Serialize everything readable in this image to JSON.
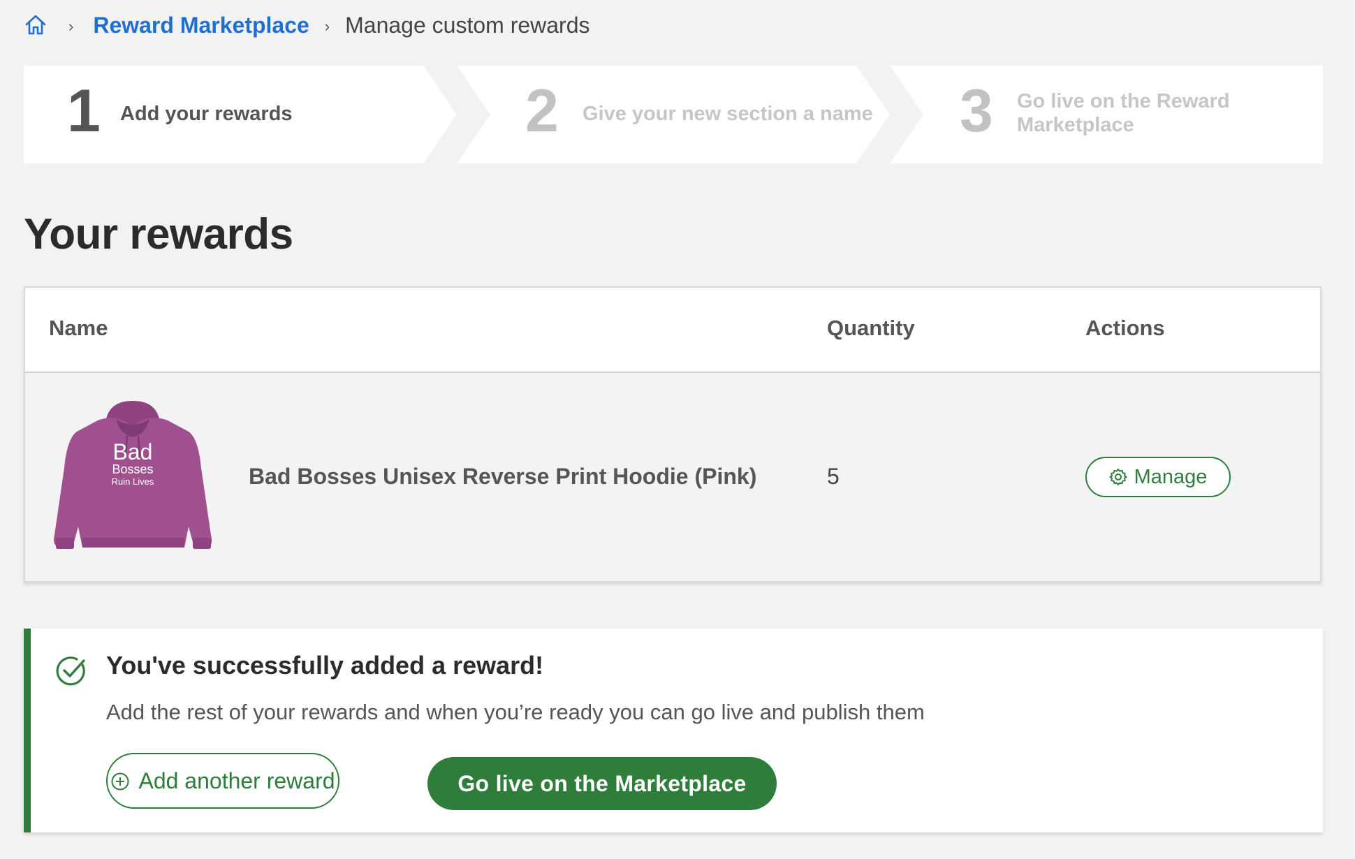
{
  "breadcrumb": {
    "home_icon": "home-icon",
    "link_label": "Reward Marketplace",
    "current_label": "Manage custom rewards",
    "separator": "›"
  },
  "stepper": {
    "steps": [
      {
        "number": "1",
        "label": "Add your rewards",
        "state": "active"
      },
      {
        "number": "2",
        "label": "Give your new section a name",
        "state": "inactive"
      },
      {
        "number": "3",
        "label": "Go live on the Reward Marketplace",
        "state": "inactive"
      }
    ]
  },
  "page": {
    "title": "Your rewards"
  },
  "table": {
    "columns": [
      "Name",
      "Quantity",
      "Actions"
    ],
    "rows": [
      {
        "image_text": [
          "Bad",
          "Bosses",
          "Ruin Lives"
        ],
        "name": "Bad Bosses Unisex Reverse Print Hoodie (Pink)",
        "quantity": "5",
        "action_label": "Manage",
        "action_icon": "gear-icon"
      }
    ]
  },
  "success": {
    "icon": "check-circle-icon",
    "title": "You've successfully added a reward!",
    "message": "Add the rest of your rewards and when you’re ready you can go live and publish them",
    "add_button": "Add another reward",
    "add_icon": "plus-circle-icon",
    "golive_button": "Go live on the Marketplace"
  },
  "colors": {
    "accent_green": "#2e7d3b",
    "link_blue": "#1f6fd1",
    "hoodie_pink": "#a0508f"
  }
}
